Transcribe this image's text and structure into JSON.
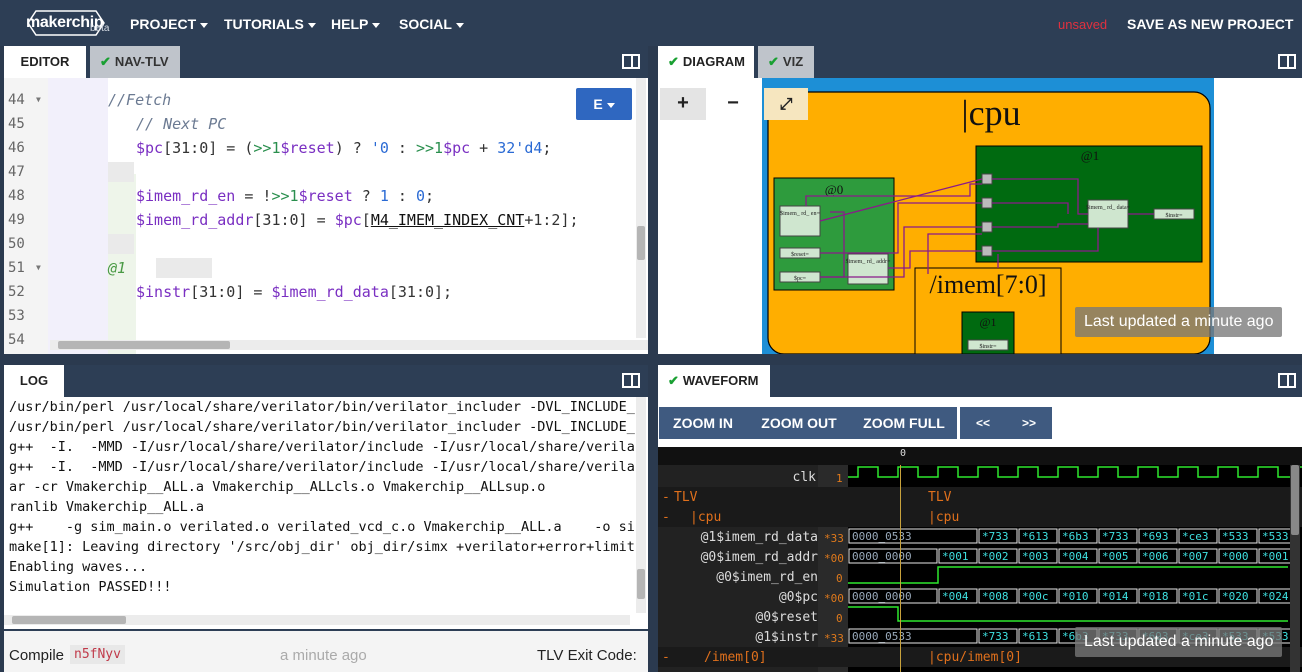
{
  "topbar": {
    "logo": "makerchip",
    "beta": "beta",
    "menu": [
      {
        "label": "PROJECT"
      },
      {
        "label": "TUTORIALS"
      },
      {
        "label": "HELP"
      },
      {
        "label": "SOCIAL"
      }
    ],
    "unsaved": "unsaved",
    "save_new": "SAVE AS NEW PROJECT"
  },
  "editor": {
    "tabs": [
      {
        "label": "EDITOR"
      },
      {
        "label": "NAV-TLV"
      }
    ],
    "e_button": "E",
    "lines": [
      {
        "num": "44"
      },
      {
        "num": "45"
      },
      {
        "num": "46"
      },
      {
        "num": "47"
      },
      {
        "num": "48"
      },
      {
        "num": "49"
      },
      {
        "num": "50"
      },
      {
        "num": "51"
      },
      {
        "num": "52"
      },
      {
        "num": "53"
      },
      {
        "num": "54"
      }
    ],
    "code": {
      "l44": "//Fetch",
      "l45": "// Next PC",
      "l46a": "$pc",
      "l46b": "[31:0] = (",
      "l46c": ">>1",
      "l46d": "$reset",
      "l46e": ") ? ",
      "l46f": "'0",
      "l46g": " : ",
      "l46h": ">>1",
      "l46i": "$pc",
      "l46j": " + ",
      "l46k": "32'd4",
      "l46l": ";",
      "l48a": "$imem_rd_en",
      "l48b": " = !",
      "l48c": ">>1",
      "l48d": "$reset",
      "l48e": " ? ",
      "l48f": "1",
      "l48g": " : ",
      "l48h": "0",
      "l48i": ";",
      "l49a": "$imem_rd_addr",
      "l49b": "[31:0] = ",
      "l49c": "$pc",
      "l49d": "[",
      "l49e": "M4_IMEM_INDEX_CNT",
      "l49f": "+1:2];",
      "l51": "@1",
      "l52a": "$instr",
      "l52b": "[31:0] = ",
      "l52c": "$imem_rd_data",
      "l52d": "[31:0];"
    }
  },
  "log": {
    "tab": "LOG",
    "lines": [
      "/usr/bin/perl /usr/local/share/verilator/bin/verilator_includer -DVL_INCLUDE_",
      "/usr/bin/perl /usr/local/share/verilator/bin/verilator_includer -DVL_INCLUDE_",
      "g++  -I.  -MMD -I/usr/local/share/verilator/include -I/usr/local/share/verila",
      "g++  -I.  -MMD -I/usr/local/share/verilator/include -I/usr/local/share/verila",
      "ar -cr Vmakerchip__ALL.a Vmakerchip__ALLcls.o Vmakerchip__ALLsup.o",
      "ranlib Vmakerchip__ALL.a",
      "g++    -g sim_main.o verilated.o verilated_vcd_c.o Vmakerchip__ALL.a    -o si",
      "make[1]: Leaving directory '/src/obj_dir' obj_dir/simx +verilator+error+limit",
      "Enabling waves...",
      "Simulation PASSED!!!"
    ],
    "compile_label": "Compile",
    "compile_id": "n5fNyv",
    "compile_time": "a minute ago",
    "exit_label": "TLV Exit Code:"
  },
  "diagram": {
    "tabs": [
      {
        "label": "DIAGRAM"
      },
      {
        "label": "VIZ"
      }
    ],
    "zoom_in": "+",
    "zoom_out": "−",
    "cpu_label": "|cpu",
    "stage1": "@1",
    "stage0": "@0",
    "imem_label": "/imem[7:0]",
    "imem_stage": "@1",
    "nodes": {
      "imem_rd_en": "$imem_\nrd_\nen=",
      "reset": "$reset=",
      "pc": "$pc=",
      "imem_rd_addr": "$imem_\nrd_\naddr=",
      "imem_rd_data": "$imem_\nrd_\ndata=",
      "instr": "$instr=",
      "imem_instr": "$instr="
    },
    "updated": "Last updated a minute ago"
  },
  "waveform": {
    "tab": "WAVEFORM",
    "buttons": {
      "zoom_in": "ZOOM IN",
      "zoom_out": "ZOOM OUT",
      "zoom_full": "ZOOM FULL",
      "prev": "<<",
      "next": ">>"
    },
    "time_zero": "0",
    "signals": [
      {
        "name": "clk",
        "val": "1"
      },
      {
        "name": "TLV",
        "val": ""
      },
      {
        "name": "|cpu",
        "val": ""
      },
      {
        "name": "@1$imem_rd_data",
        "val": "*33"
      },
      {
        "name": "@0$imem_rd_addr",
        "val": "*00"
      },
      {
        "name": "@0$imem_rd_en",
        "val": "0"
      },
      {
        "name": "@0$pc",
        "val": "*00"
      },
      {
        "name": "@0$reset",
        "val": "0"
      },
      {
        "name": "@1$instr",
        "val": "*33"
      },
      {
        "name": "/imem[0]",
        "val": ""
      }
    ],
    "scopes": {
      "tlv": "TLV",
      "cpu": "|cpu",
      "imem": "|cpu/imem[0]"
    },
    "buses": {
      "imem_rd_data": [
        "0000_0533",
        "*733",
        "*613",
        "*6b3",
        "*733",
        "*693",
        "*ce3",
        "*533",
        "*533"
      ],
      "imem_rd_addr": [
        "0000_0000",
        "*001",
        "*002",
        "*003",
        "*004",
        "*005",
        "*006",
        "*007",
        "*000",
        "*001"
      ],
      "pc": [
        "0000_0000",
        "*004",
        "*008",
        "*00c",
        "*010",
        "*014",
        "*018",
        "*01c",
        "*020",
        "*024"
      ],
      "instr": [
        "0000_0533",
        "*733",
        "*613",
        "*6b3",
        "*733",
        "*693",
        "*ce3",
        "*533",
        "*533"
      ]
    },
    "updated": "Last updated a minute ago"
  }
}
